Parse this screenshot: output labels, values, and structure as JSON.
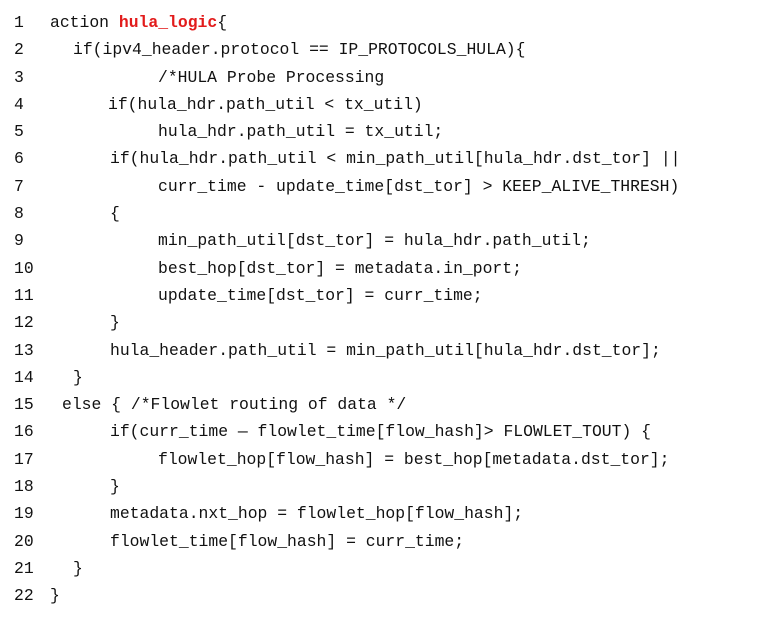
{
  "code": {
    "highlight_color": "#e21b1b",
    "lines": [
      {
        "num": "1",
        "pre": "action ",
        "hl": "hula_logic",
        "post": "{"
      },
      {
        "num": "2",
        "pre": "if(ipv4_header.protocol == IP_PROTOCOLS_HULA){",
        "hl": "",
        "post": ""
      },
      {
        "num": "3",
        "pre": "/*HULA Probe Processing",
        "hl": "",
        "post": ""
      },
      {
        "num": "4",
        "pre": "if(hula_hdr.path_util < tx_util)",
        "hl": "",
        "post": ""
      },
      {
        "num": "5",
        "pre": "hula_hdr.path_util = tx_util;",
        "hl": "",
        "post": ""
      },
      {
        "num": "6",
        "pre": "if(hula_hdr.path_util < min_path_util[hula_hdr.dst_tor] ||",
        "hl": "",
        "post": ""
      },
      {
        "num": "7",
        "pre": "curr_time - update_time[dst_tor] > KEEP_ALIVE_THRESH)",
        "hl": "",
        "post": ""
      },
      {
        "num": "8",
        "pre": "{",
        "hl": "",
        "post": ""
      },
      {
        "num": "9",
        "pre": "min_path_util[dst_tor] = hula_hdr.path_util;",
        "hl": "",
        "post": ""
      },
      {
        "num": "10",
        "pre": "best_hop[dst_tor] = metadata.in_port;",
        "hl": "",
        "post": ""
      },
      {
        "num": "11",
        "pre": "update_time[dst_tor] = curr_time;",
        "hl": "",
        "post": ""
      },
      {
        "num": "12",
        "pre": "}",
        "hl": "",
        "post": ""
      },
      {
        "num": "13",
        "pre": "hula_header.path_util = min_path_util[hula_hdr.dst_tor];",
        "hl": "",
        "post": ""
      },
      {
        "num": "14",
        "pre": "}",
        "hl": "",
        "post": ""
      },
      {
        "num": "15",
        "pre": "else { /*Flowlet routing of data */",
        "hl": "",
        "post": ""
      },
      {
        "num": "16",
        "pre": "if(curr_time — flowlet_time[flow_hash]> FLOWLET_TOUT) {",
        "hl": "",
        "post": ""
      },
      {
        "num": "17",
        "pre": "flowlet_hop[flow_hash] = best_hop[metadata.dst_tor];",
        "hl": "",
        "post": ""
      },
      {
        "num": "18",
        "pre": "}",
        "hl": "",
        "post": ""
      },
      {
        "num": "19",
        "pre": "metadata.nxt_hop = flowlet_hop[flow_hash];",
        "hl": "",
        "post": ""
      },
      {
        "num": "20",
        "pre": "flowlet_time[flow_hash] = curr_time;",
        "hl": "",
        "post": ""
      },
      {
        "num": "21",
        "pre": "}",
        "hl": "",
        "post": ""
      },
      {
        "num": "22",
        "pre": "}",
        "hl": "",
        "post": ""
      }
    ]
  }
}
